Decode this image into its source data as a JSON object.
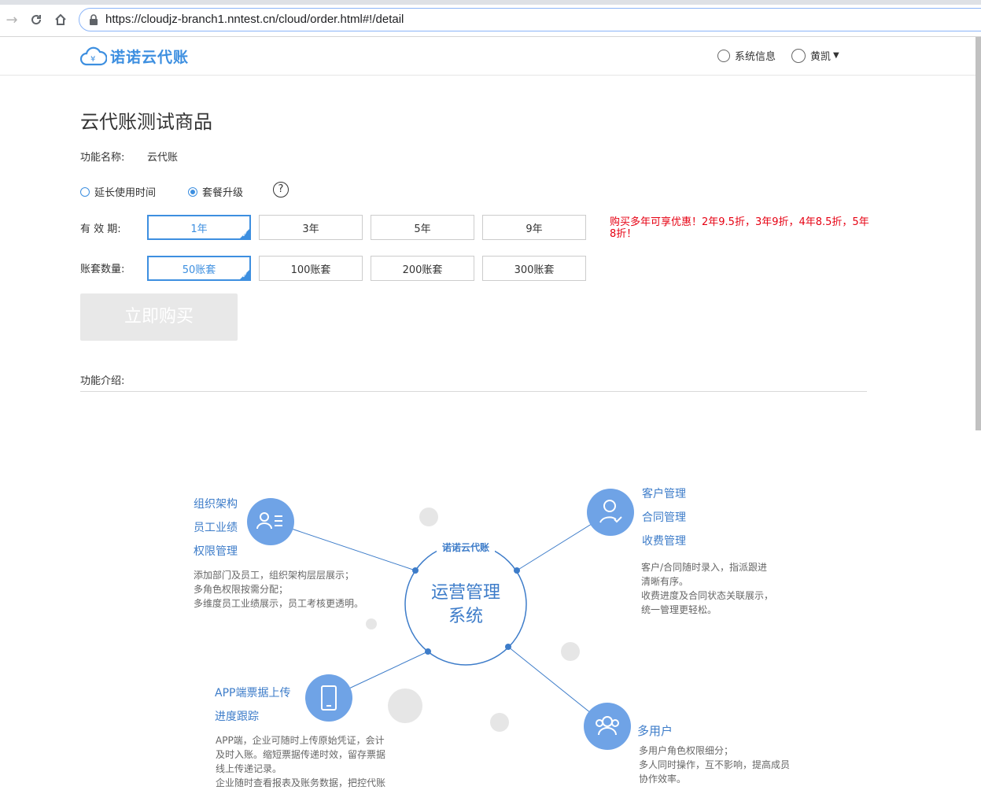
{
  "browser": {
    "url": "https://cloudjz-branch1.nntest.cn/cloud/order.html#!/detail"
  },
  "header": {
    "logo_text": "诺诺云代账",
    "system_info": "系统信息",
    "user_name": "黄凯"
  },
  "product": {
    "title": "云代账测试商品",
    "feature_name_label": "功能名称:",
    "feature_name_value": "云代账",
    "radio_options": [
      {
        "label": "延长使用时间",
        "checked": false
      },
      {
        "label": "套餐升级",
        "checked": true
      }
    ],
    "help_label": "?",
    "validity_label": "有 效 期:",
    "validity_options": [
      "1年",
      "3年",
      "5年",
      "9年"
    ],
    "validity_selected": "1年",
    "promo_text": "购买多年可享优惠！2年9.5折，3年9折，4年8.5折，5年8折！",
    "accounts_label": "账套数量:",
    "account_options": [
      "50账套",
      "100账套",
      "200账套",
      "300账套"
    ],
    "accounts_selected": "50账套",
    "buy_button": "立即购买",
    "intro_label": "功能介绍:"
  },
  "diagram": {
    "brand": "诺诺云代账",
    "center_line1": "运营管理",
    "center_line2": "系统",
    "top_left": {
      "items": [
        "组织架构",
        "员工业绩",
        "权限管理"
      ],
      "desc": [
        "添加部门及员工，组织架构层层展示；",
        "多角色权限按需分配；",
        "多维度员工业绩展示，员工考核更透明。"
      ]
    },
    "top_right": {
      "items": [
        "客户管理",
        "合同管理",
        "收费管理"
      ],
      "desc": [
        "客户/合同随时录入，指派跟进",
        "清晰有序。",
        "收费进度及合同状态关联展示，",
        "统一管理更轻松。"
      ]
    },
    "bottom_left": {
      "items": [
        "APP端票据上传",
        "进度跟踪"
      ],
      "desc": [
        "APP端，企业可随时上传原始凭证，会计",
        "及时入账。缩短票据传递时效，留存票据",
        "线上传递记录。",
        "企业随时查看报表及账务数据，把控代账"
      ]
    },
    "bottom_right": {
      "items": [
        "多用户"
      ],
      "desc": [
        "多用户角色权限细分；",
        "多人同时操作，互不影响，提高成员",
        "协作效率。"
      ]
    },
    "colors": {
      "accent": "#3d8fe0",
      "node": "#6fa3e6",
      "line": "#3d7cc9",
      "bubble": "#e6e6e6"
    }
  }
}
